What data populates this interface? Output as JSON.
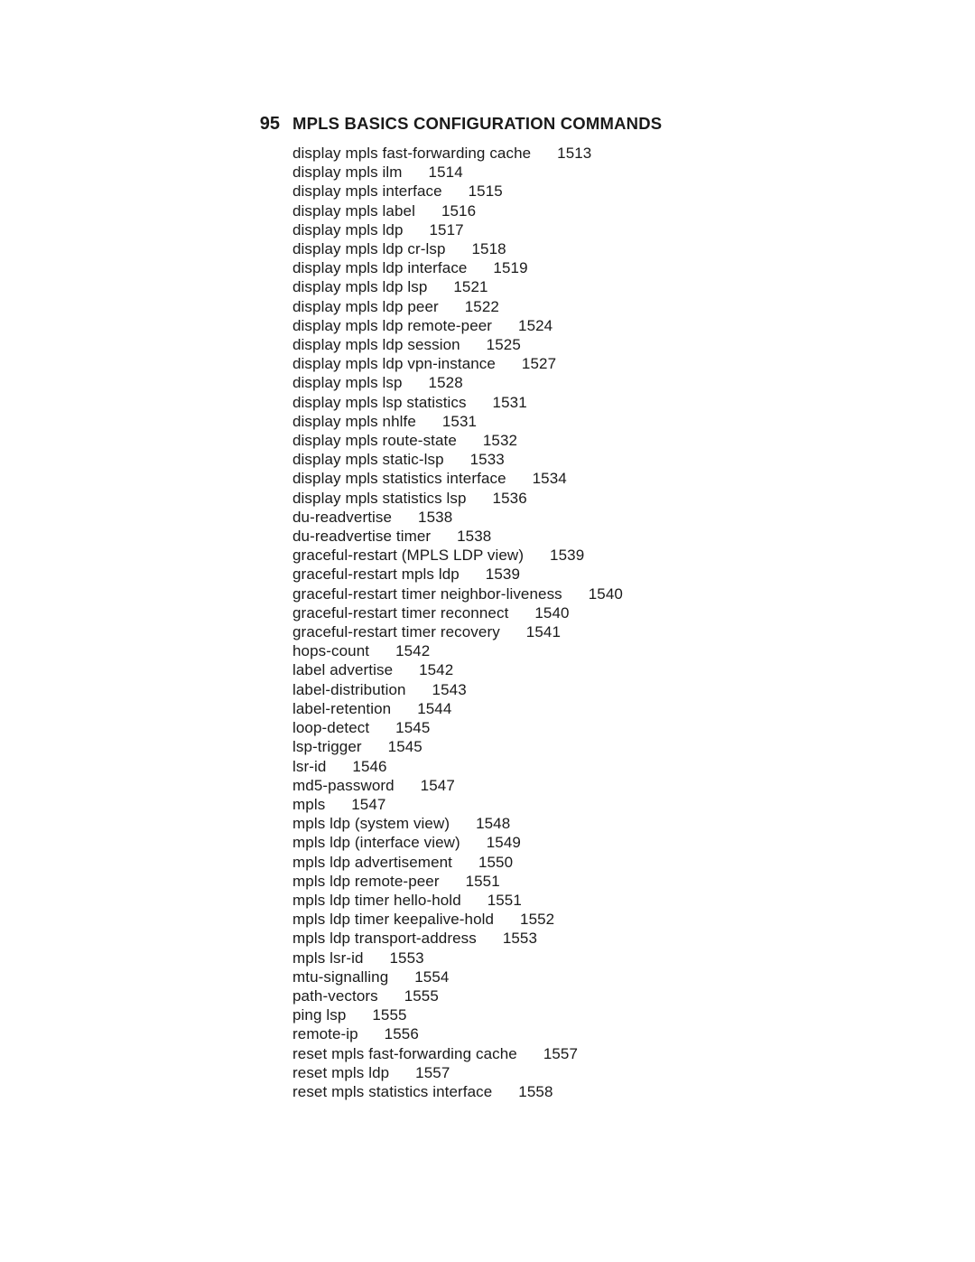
{
  "chapter": {
    "number": "95",
    "title_lead": "MPLS B",
    "title_rest": "ASICS CONFIGURATION COMMANDS"
  },
  "entries": [
    {
      "cmd": "display mpls fast-forwarding cache",
      "page": "1513"
    },
    {
      "cmd": "display mpls ilm",
      "page": "1514"
    },
    {
      "cmd": "display mpls interface",
      "page": "1515"
    },
    {
      "cmd": "display mpls label",
      "page": "1516"
    },
    {
      "cmd": "display mpls ldp",
      "page": "1517"
    },
    {
      "cmd": "display mpls ldp cr-lsp",
      "page": "1518"
    },
    {
      "cmd": "display mpls ldp interface",
      "page": "1519"
    },
    {
      "cmd": "display mpls ldp lsp",
      "page": "1521"
    },
    {
      "cmd": "display mpls ldp peer",
      "page": "1522"
    },
    {
      "cmd": "display mpls ldp remote-peer",
      "page": "1524"
    },
    {
      "cmd": "display mpls ldp session",
      "page": "1525"
    },
    {
      "cmd": "display mpls ldp vpn-instance",
      "page": "1527"
    },
    {
      "cmd": "display mpls lsp",
      "page": "1528"
    },
    {
      "cmd": "display mpls lsp statistics",
      "page": "1531"
    },
    {
      "cmd": "display mpls nhlfe",
      "page": "1531"
    },
    {
      "cmd": "display mpls route-state",
      "page": "1532"
    },
    {
      "cmd": "display mpls static-lsp",
      "page": "1533"
    },
    {
      "cmd": "display mpls statistics interface",
      "page": "1534"
    },
    {
      "cmd": "display mpls statistics lsp",
      "page": "1536"
    },
    {
      "cmd": "du-readvertise",
      "page": "1538"
    },
    {
      "cmd": "du-readvertise timer",
      "page": "1538"
    },
    {
      "cmd": "graceful-restart (MPLS LDP view)",
      "page": "1539"
    },
    {
      "cmd": "graceful-restart mpls ldp",
      "page": "1539"
    },
    {
      "cmd": "graceful-restart timer neighbor-liveness",
      "page": "1540"
    },
    {
      "cmd": "graceful-restart timer reconnect",
      "page": "1540"
    },
    {
      "cmd": "graceful-restart timer recovery",
      "page": "1541"
    },
    {
      "cmd": "hops-count",
      "page": "1542"
    },
    {
      "cmd": "label advertise",
      "page": "1542"
    },
    {
      "cmd": "label-distribution",
      "page": "1543"
    },
    {
      "cmd": "label-retention",
      "page": "1544"
    },
    {
      "cmd": "loop-detect",
      "page": "1545"
    },
    {
      "cmd": "lsp-trigger",
      "page": "1545"
    },
    {
      "cmd": "lsr-id",
      "page": "1546"
    },
    {
      "cmd": "md5-password",
      "page": "1547"
    },
    {
      "cmd": "mpls",
      "page": "1547"
    },
    {
      "cmd": "mpls ldp (system view)",
      "page": "1548"
    },
    {
      "cmd": "mpls ldp (interface view)",
      "page": "1549"
    },
    {
      "cmd": "mpls ldp advertisement",
      "page": "1550"
    },
    {
      "cmd": "mpls ldp remote-peer",
      "page": "1551"
    },
    {
      "cmd": "mpls ldp timer hello-hold",
      "page": "1551"
    },
    {
      "cmd": "mpls ldp timer keepalive-hold",
      "page": "1552"
    },
    {
      "cmd": "mpls ldp transport-address",
      "page": "1553"
    },
    {
      "cmd": "mpls lsr-id",
      "page": "1553"
    },
    {
      "cmd": "mtu-signalling",
      "page": "1554"
    },
    {
      "cmd": "path-vectors",
      "page": "1555"
    },
    {
      "cmd": "ping lsp",
      "page": "1555"
    },
    {
      "cmd": "remote-ip",
      "page": "1556"
    },
    {
      "cmd": "reset mpls fast-forwarding cache",
      "page": "1557"
    },
    {
      "cmd": "reset mpls ldp",
      "page": "1557"
    },
    {
      "cmd": "reset mpls statistics interface",
      "page": "1558"
    }
  ]
}
